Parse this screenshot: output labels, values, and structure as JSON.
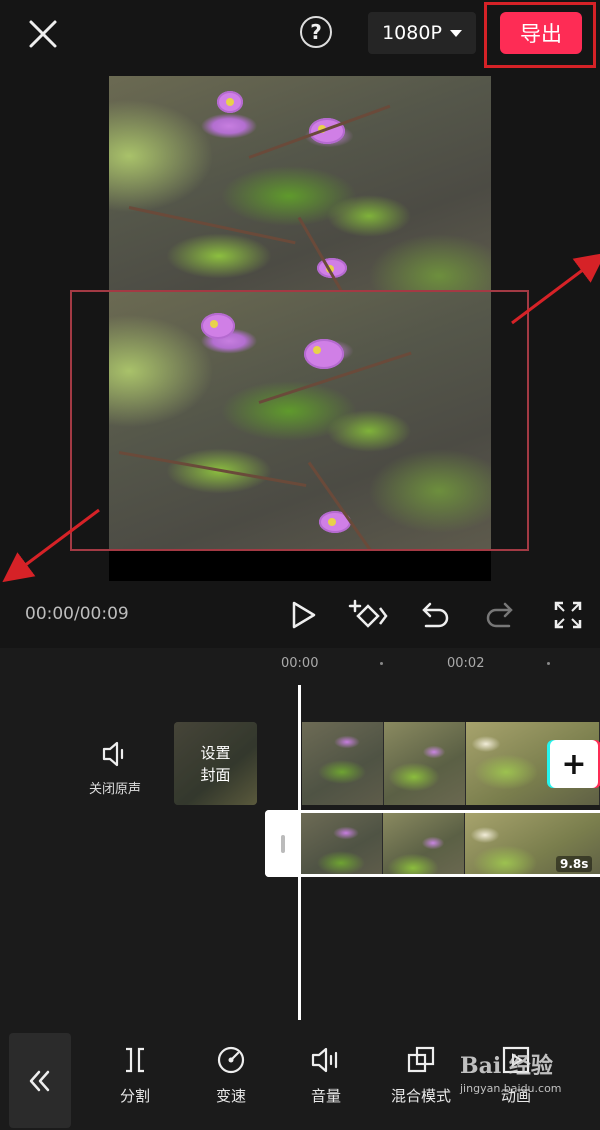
{
  "topbar": {
    "resolution": "1080P",
    "export_label": "导出"
  },
  "player": {
    "timecode": "00:00/00:09"
  },
  "timeline": {
    "ruler": [
      "00:00",
      "00:02"
    ],
    "mute_label": "关闭原声",
    "cover_label_line1": "设置",
    "cover_label_line2": "封面",
    "clip_duration": "9.8s"
  },
  "toolbar": {
    "items": [
      {
        "label": "分割",
        "icon": "split-icon"
      },
      {
        "label": "变速",
        "icon": "speed-icon"
      },
      {
        "label": "音量",
        "icon": "volume-icon"
      },
      {
        "label": "混合模式",
        "icon": "blend-mode-icon"
      },
      {
        "label": "动画",
        "icon": "animation-icon"
      }
    ]
  },
  "watermark": {
    "logo": "Bai 经验",
    "url": "jingyan.baidu.com"
  },
  "colors": {
    "accent": "#fe2c55",
    "annotation_red": "#d62227"
  }
}
